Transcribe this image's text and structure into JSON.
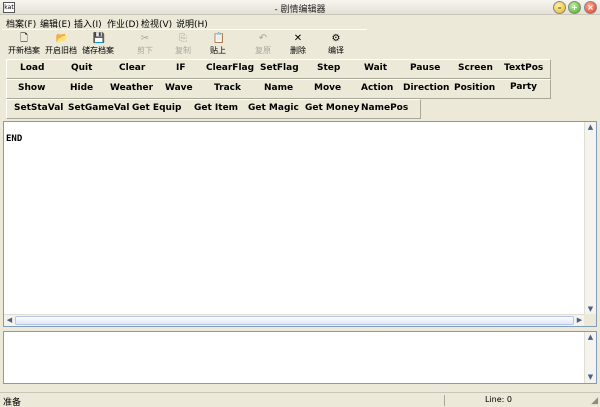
{
  "window": {
    "title": "- 剧情编辑器",
    "icon_text": "kat"
  },
  "menu": [
    "档案(F)",
    "编辑(E)",
    "插入(I)",
    "作业(D)",
    "检视(V)",
    "说明(H)"
  ],
  "toolbar": [
    {
      "label": "开新档案",
      "icon": "new-file-icon",
      "glyph": "🗋",
      "enabled": true
    },
    {
      "label": "开启旧档",
      "icon": "open-folder-icon",
      "glyph": "📂",
      "enabled": true
    },
    {
      "label": "储存档案",
      "icon": "save-disk-icon",
      "glyph": "💾",
      "enabled": true
    },
    {
      "label": "剪下",
      "icon": "cut-scissors-icon",
      "glyph": "✂",
      "enabled": false
    },
    {
      "label": "复制",
      "icon": "copy-icon",
      "glyph": "⎘",
      "enabled": false
    },
    {
      "label": "贴上",
      "icon": "paste-clipboard-icon",
      "glyph": "📋",
      "enabled": true
    },
    {
      "label": "复原",
      "icon": "undo-icon",
      "glyph": "↶",
      "enabled": false
    },
    {
      "label": "删除",
      "icon": "delete-x-icon",
      "glyph": "✕",
      "enabled": true
    },
    {
      "label": "编译",
      "icon": "compile-icon",
      "glyph": "⚙",
      "enabled": true
    }
  ],
  "commands_row1": [
    "Load",
    "Quit",
    "Clear",
    "IF",
    "ClearFlag",
    "SetFlag",
    "Step",
    "Wait",
    "Pause",
    "Screen",
    "TextPos"
  ],
  "commands_row2": [
    "Show",
    "Hide",
    "Weather",
    "Wave",
    "Track",
    "Name",
    "Move",
    "Action",
    "Direction",
    "Position",
    "Party"
  ],
  "commands_row3": [
    "SetStaVal",
    "SetGameVal",
    "Get Equip",
    "Get Item",
    "Get Magic",
    "Get Money",
    "NamePos"
  ],
  "editor": {
    "content": "END"
  },
  "status": {
    "text": "准备",
    "line": "Line: 0"
  },
  "colors": {
    "window_bg": "#ece9d8",
    "field_border": "#7f9db9",
    "close": "#d8361c",
    "maximize": "#3fa51c",
    "minimize": "#e2b41c"
  }
}
